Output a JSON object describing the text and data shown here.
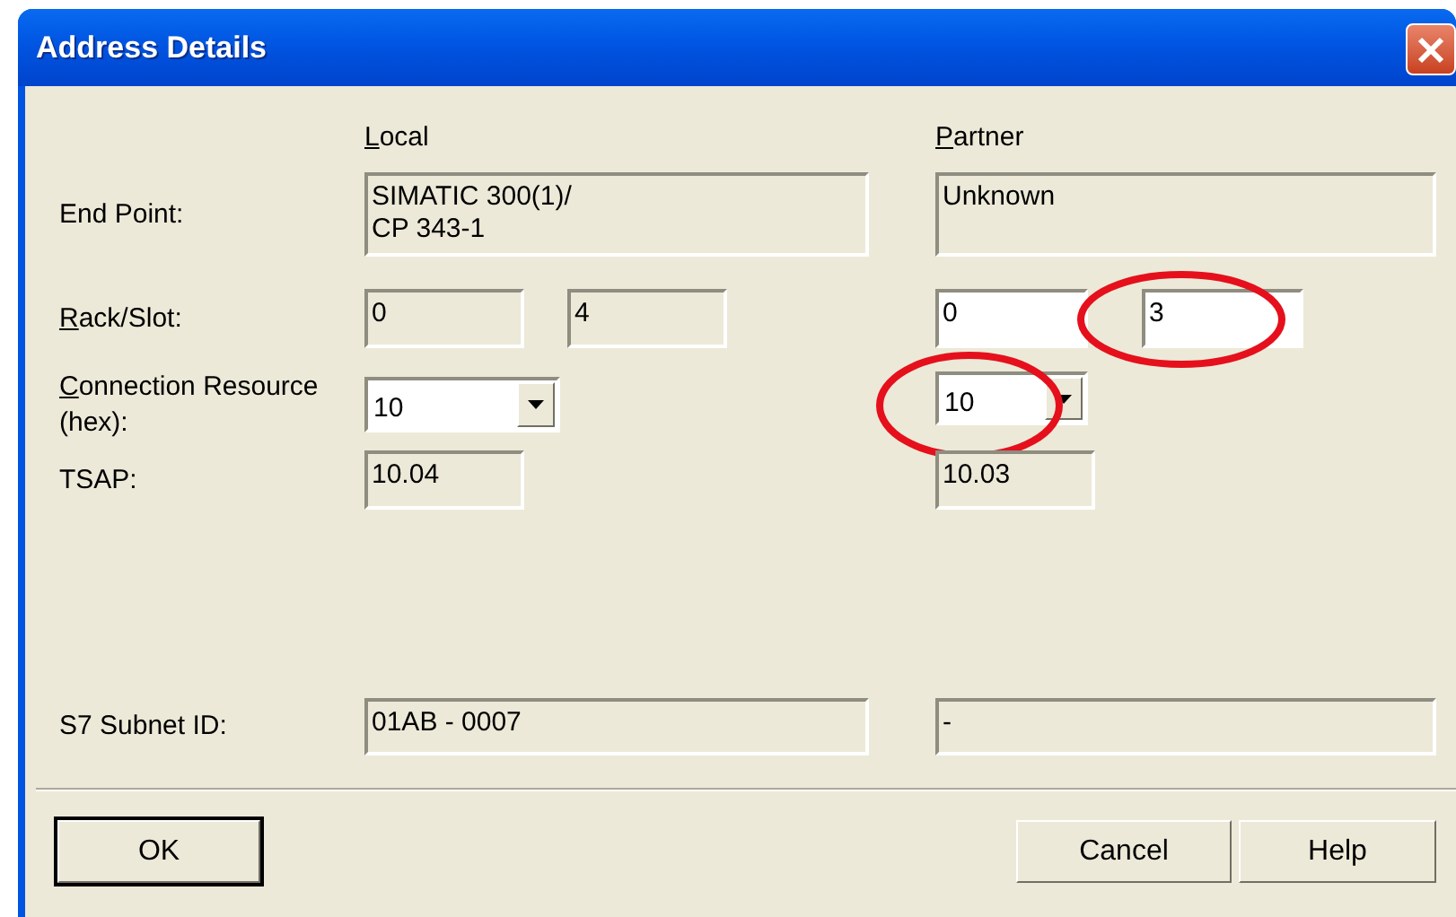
{
  "window": {
    "title": "Address Details"
  },
  "columns": [
    {
      "label": "Local",
      "mnemonic_first": true
    },
    {
      "label": "Partner",
      "mnemonic_first": true
    }
  ],
  "rows": [
    {
      "label": "End Point:",
      "mnemonic_first": false,
      "local": [
        {
          "kind": "text",
          "value": "SIMATIC 300(1)/\nCP 343-1",
          "editable": false,
          "circled": false
        }
      ],
      "partner": [
        {
          "kind": "text",
          "value": "Unknown",
          "editable": false,
          "circled": false
        }
      ]
    },
    {
      "label": "Rack/Slot:",
      "mnemonic_first": true,
      "local": [
        {
          "kind": "text",
          "value": "0",
          "editable": false,
          "circled": false
        },
        {
          "kind": "text",
          "value": "4",
          "editable": false,
          "circled": false
        }
      ],
      "partner": [
        {
          "kind": "text",
          "value": "0",
          "editable": true,
          "circled": false
        },
        {
          "kind": "text",
          "value": "3",
          "editable": true,
          "circled": true
        }
      ]
    },
    {
      "label": "Connection Resource\n(hex):",
      "mnemonic_first": true,
      "local": [
        {
          "kind": "dropdown",
          "value": "10",
          "editable": true,
          "circled": false
        }
      ],
      "partner": [
        {
          "kind": "dropdown",
          "value": "10",
          "editable": true,
          "circled": true
        }
      ]
    },
    {
      "label": "TSAP:",
      "mnemonic_first": false,
      "local": [
        {
          "kind": "text",
          "value": "10.04",
          "editable": false,
          "circled": false
        }
      ],
      "partner": [
        {
          "kind": "text",
          "value": "10.03",
          "editable": false,
          "circled": false
        }
      ]
    },
    {
      "label": "S7 Subnet ID:",
      "mnemonic_first": false,
      "local": [
        {
          "kind": "text",
          "value": "01AB - 0007",
          "editable": false,
          "circled": false
        }
      ],
      "partner": [
        {
          "kind": "text",
          "value": "-",
          "editable": false,
          "circled": false
        }
      ]
    }
  ],
  "buttons": [
    {
      "label": "OK",
      "default": true
    },
    {
      "label": "Cancel",
      "default": false
    },
    {
      "label": "Help",
      "default": false
    }
  ]
}
